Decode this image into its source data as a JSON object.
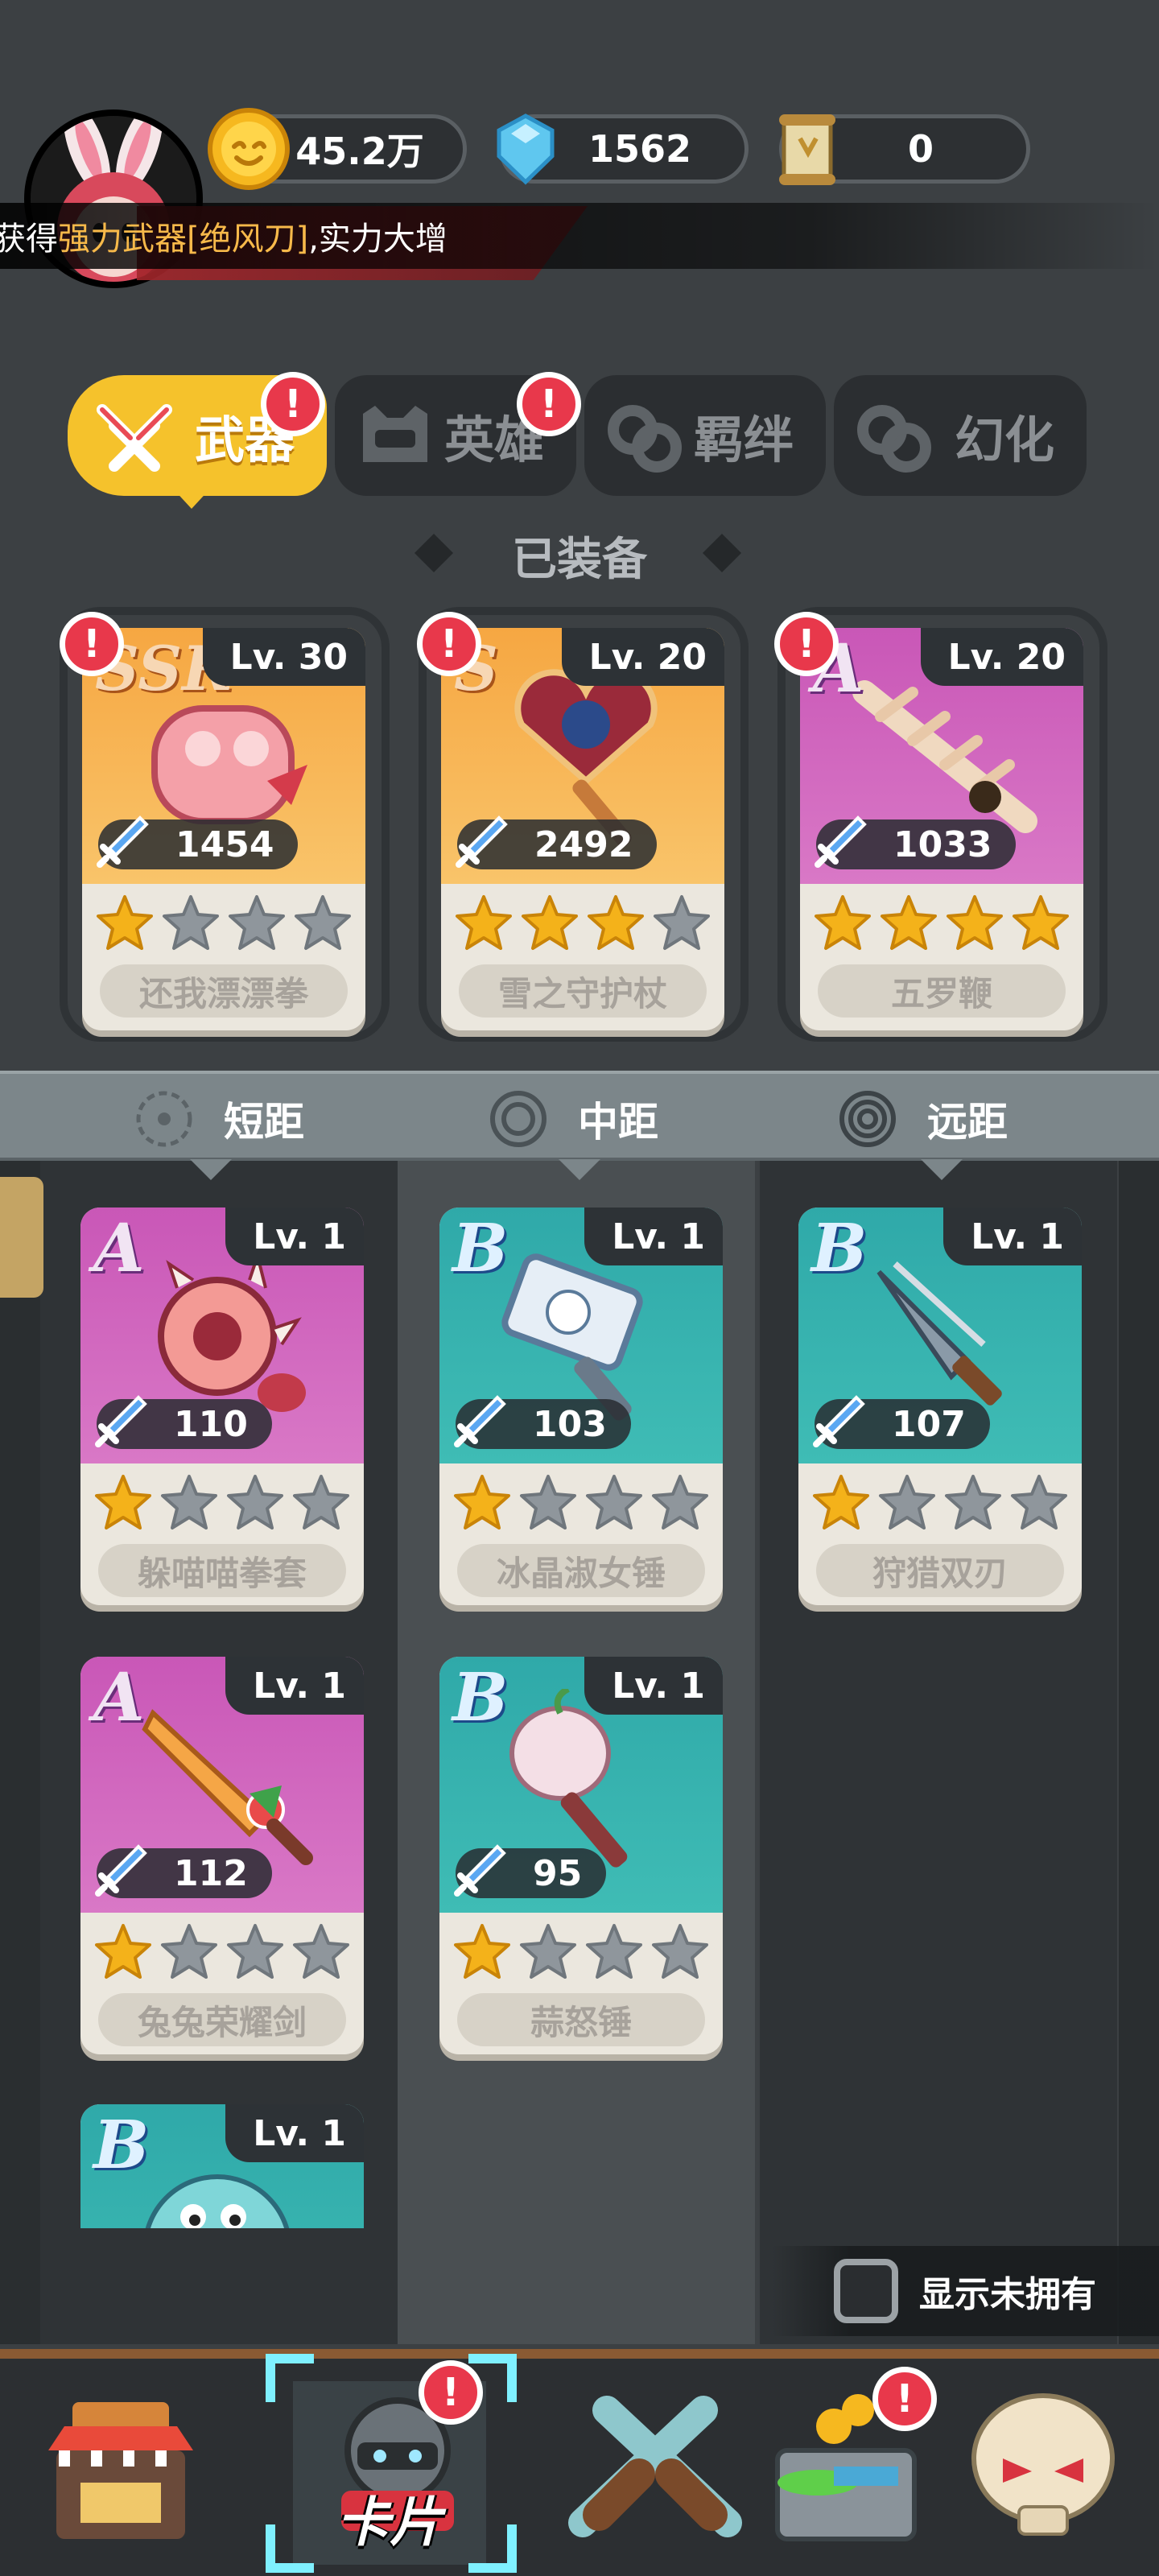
{
  "currency": {
    "gold": "45.2万",
    "diamond": "1562",
    "scroll": "0"
  },
  "news": {
    "prefix": "获得",
    "highlight": "强力武器[绝风刀]",
    "suffix": ",实力大增"
  },
  "tabs": [
    {
      "label": "武器",
      "active": true,
      "alert": "!"
    },
    {
      "label": "英雄",
      "active": false,
      "alert": "!"
    },
    {
      "label": "羁绊",
      "active": false
    },
    {
      "label": "幻化",
      "active": false
    }
  ],
  "equipped_title": "已装备",
  "equipped": [
    {
      "rarity": "SSR",
      "level": "Lv. 30",
      "power": "1454",
      "name": "还我漂漂拳",
      "stars": 1,
      "alert": "!"
    },
    {
      "rarity": "S",
      "level": "Lv. 20",
      "power": "2492",
      "name": "雪之守护杖",
      "stars": 3,
      "alert": "!"
    },
    {
      "rarity": "A",
      "level": "Lv. 20",
      "power": "1033",
      "name": "五罗鞭",
      "stars": 4,
      "alert": "!"
    }
  ],
  "filters": [
    "短距",
    "中距",
    "远距"
  ],
  "columns": {
    "short": [
      {
        "rarity": "A",
        "level": "Lv. 1",
        "power": "110",
        "name": "躲喵喵拳套",
        "stars": 1
      },
      {
        "rarity": "A",
        "level": "Lv. 1",
        "power": "112",
        "name": "兔兔荣耀剑",
        "stars": 1
      },
      {
        "rarity": "B",
        "level": "Lv. 1"
      }
    ],
    "mid": [
      {
        "rarity": "B",
        "level": "Lv. 1",
        "power": "103",
        "name": "冰晶淑女锤",
        "stars": 1
      },
      {
        "rarity": "B",
        "level": "Lv. 1",
        "power": "95",
        "name": "蒜怒锤",
        "stars": 1
      }
    ],
    "long": [
      {
        "rarity": "B",
        "level": "Lv. 1",
        "power": "107",
        "name": "狩猎双刃",
        "stars": 1
      }
    ]
  },
  "show_unowned": "显示未拥有",
  "bottom_nav": {
    "active_label": "卡片",
    "alert": "!"
  },
  "colors": {
    "gold_tab": "#f5c22c",
    "alert_red": "#e8384b",
    "rarity_ssr_bg": "#f6a742",
    "rarity_a_bg": "#c957b7",
    "rarity_b_bg": "#2fa9a9",
    "star_on": "#f4b21a",
    "star_off": "#8f969c"
  }
}
